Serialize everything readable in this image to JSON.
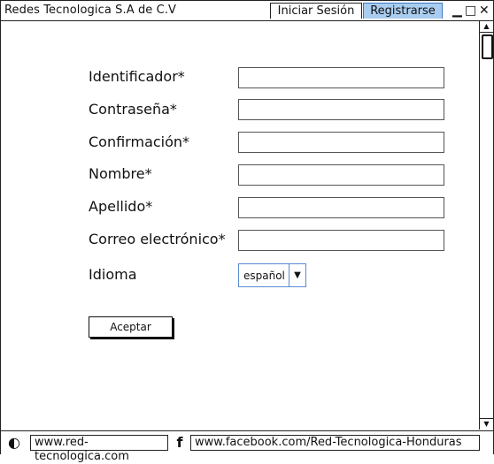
{
  "app": {
    "title": "Redes Tecnologica S.A de C.V"
  },
  "tabs": [
    {
      "label": "Iniciar Sesión",
      "active": false
    },
    {
      "label": "Registrarse",
      "active": true
    }
  ],
  "window_controls": {
    "minimize": "▁",
    "maximize": "□",
    "close": "✕"
  },
  "form": {
    "fields": [
      {
        "label": "Identificador*",
        "value": ""
      },
      {
        "label": "Contraseña*",
        "value": ""
      },
      {
        "label": "Confirmación*",
        "value": ""
      },
      {
        "label": "Nombre*",
        "value": ""
      },
      {
        "label": "Apellido*",
        "value": ""
      },
      {
        "label": "Correo electrónico*",
        "value": ""
      }
    ],
    "language": {
      "label": "Idioma",
      "value": "español"
    },
    "submit_label": "Aceptar"
  },
  "footer": {
    "site_link": "www.red-tecnologica.com",
    "facebook_link": "www.facebook.com/Red-Tecnologica-Honduras",
    "icons": [
      "browser-icon",
      "facebook-icon"
    ]
  }
}
